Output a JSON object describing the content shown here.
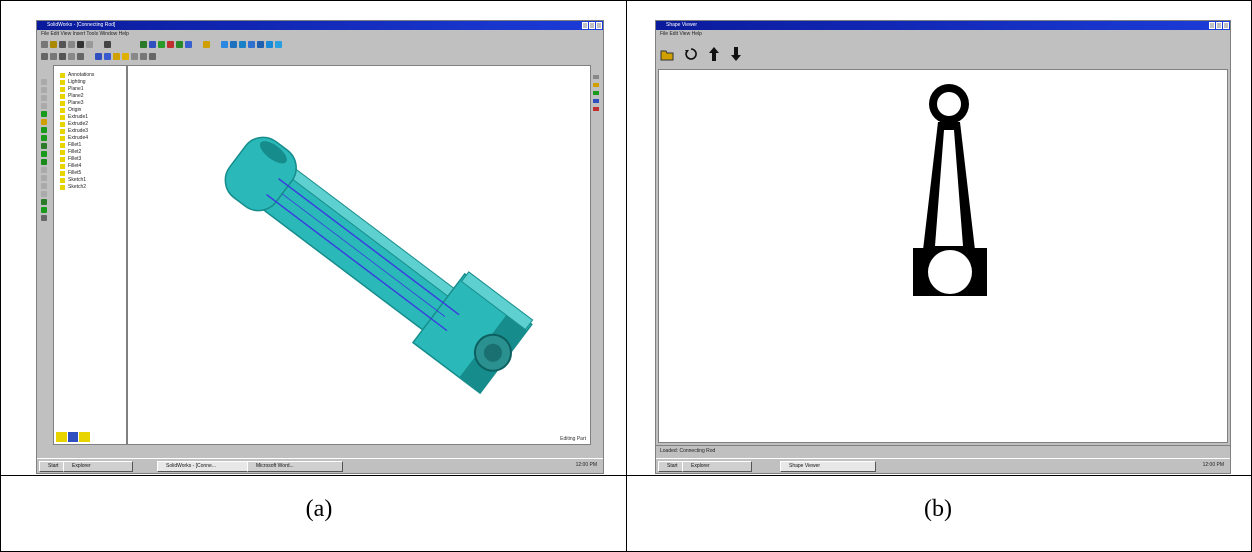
{
  "captions": {
    "a": "(a)",
    "b": "(b)"
  },
  "panel_a": {
    "title": "SolidWorks - [Connecting Rod]",
    "menu": "File  Edit  View  Insert  Tools  Window  Help",
    "tree_items": [
      "Annotations",
      "Lighting",
      "Plane1",
      "Plane2",
      "Plane3",
      "Origin",
      "Extrude1",
      "Extrude2",
      "Extrude3",
      "Extrude4",
      "Fillet1",
      "Fillet2",
      "Fillet3",
      "Fillet4",
      "Fillet5",
      "Sketch1",
      "Sketch2"
    ],
    "taskbar": {
      "start": "Start",
      "items": [
        "Explorer",
        "SolidWorks - [Conne...",
        "Microsoft Word..."
      ],
      "clock": "12:00 PM"
    },
    "status": "Editing Part"
  },
  "panel_b": {
    "title": "Shape Viewer",
    "menu": "File  Edit  View  Help",
    "status": "Loaded: Connecting Rod",
    "taskbar": {
      "start": "Start",
      "items": [
        "Explorer",
        "Shape Viewer"
      ],
      "clock": "12:00 PM"
    }
  },
  "colors": {
    "titlebar": "#1428b8",
    "part": "#2ab8b8",
    "part_dark": "#168c8c",
    "edges": "#3a3ae0",
    "desktop": "#c0c0c0"
  }
}
